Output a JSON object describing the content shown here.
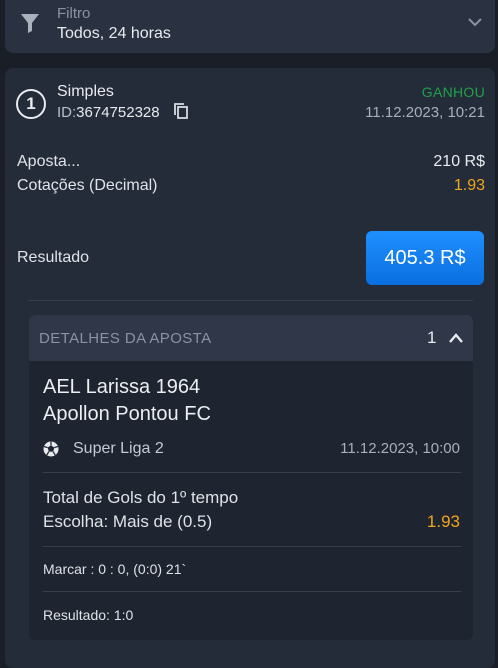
{
  "filter": {
    "label": "Filtro",
    "value": "Todos, 24 horas"
  },
  "bet": {
    "number": "1",
    "type": "Simples",
    "id_label": "ID:",
    "id_value": "3674752328",
    "status": "GANHOU",
    "datetime": "11.12.2023, 10:21",
    "stake_label": "Aposta...",
    "stake_value": "210 R$",
    "odds_label": "Cotações (Decimal)",
    "odds_value": "1.93",
    "result_label": "Resultado",
    "result_value": "405.3 R$"
  },
  "details": {
    "title": "DETALHES DA APOSTA",
    "count": "1",
    "team_home": "AEL Larissa 1964",
    "team_away": "Apollon Pontou FC",
    "league": "Super Liga 2",
    "event_datetime": "11.12.2023, 10:00",
    "market": "Total de Gols do 1º tempo",
    "choice": "Escolha: Mais de (0.5)",
    "choice_odds": "1.93",
    "score": "Marcar : 0 : 0, (0:0) 21`",
    "final_result": "Resultado: 1:0"
  },
  "colors": {
    "background": "#191e27",
    "card": "#252c39",
    "won": "#1fa04a",
    "odds": "#f1a51c",
    "accent": "#0a6fe0"
  },
  "icons": [
    "funnel-icon",
    "chevron-down-icon",
    "copy-icon",
    "chevron-up-icon",
    "soccer-ball-icon"
  ]
}
